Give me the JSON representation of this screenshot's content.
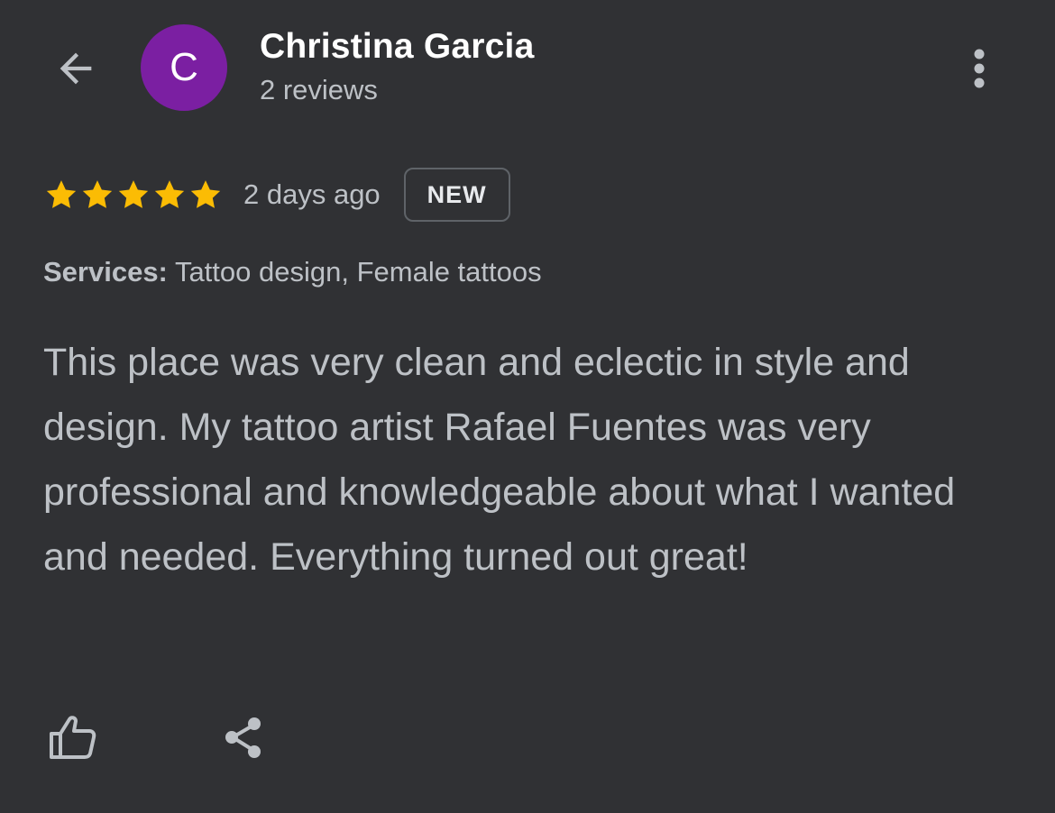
{
  "header": {
    "back_icon": "arrow-left-icon",
    "avatar_initial": "C",
    "avatar_color": "#7b1fa2",
    "reviewer_name": "Christina Garcia",
    "review_count": "2 reviews",
    "more_icon": "more-vert-icon"
  },
  "review": {
    "rating": 5,
    "max_rating": 5,
    "star_color": "#fbbc04",
    "time_ago": "2 days ago",
    "badge": "NEW",
    "services_label": "Services:",
    "services_value": " Tattoo design, Female tattoos",
    "text": "This place was very clean and eclectic in style and design. My tattoo artist Rafael Fuentes was very professional and knowledgeable about what I wanted and needed. Everything turned out great!"
  },
  "actions": {
    "like_icon": "thumb-up-icon",
    "share_icon": "share-icon"
  }
}
